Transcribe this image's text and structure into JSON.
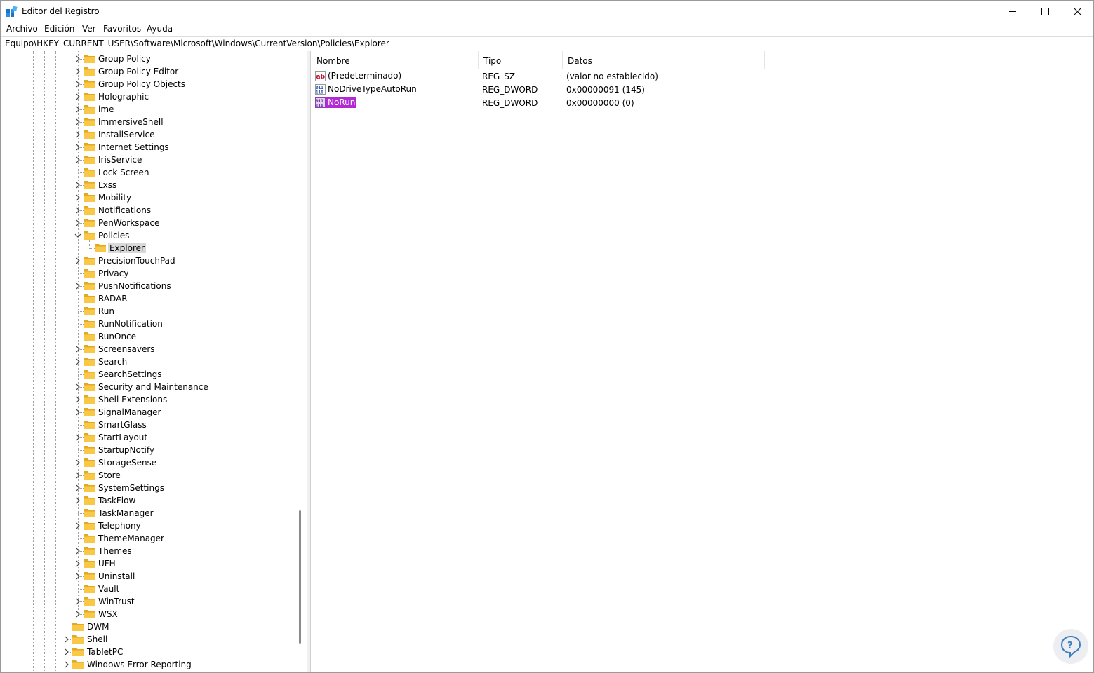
{
  "window": {
    "title": "Editor del Registro",
    "controls": {
      "minimize": "minimize-icon",
      "maximize": "maximize-icon",
      "close": "close-icon"
    }
  },
  "menu": [
    "Archivo",
    "Edición",
    "Ver",
    "Favoritos",
    "Ayuda"
  ],
  "address": "Equipo\\HKEY_CURRENT_USER\\Software\\Microsoft\\Windows\\CurrentVersion\\Policies\\Explorer",
  "tree": {
    "items": [
      {
        "label": "Group Policy",
        "level": 1,
        "expander": "collapsed"
      },
      {
        "label": "Group Policy Editor",
        "level": 1,
        "expander": "collapsed"
      },
      {
        "label": "Group Policy Objects",
        "level": 1,
        "expander": "collapsed"
      },
      {
        "label": "Holographic",
        "level": 1,
        "expander": "collapsed"
      },
      {
        "label": "ime",
        "level": 1,
        "expander": "collapsed"
      },
      {
        "label": "ImmersiveShell",
        "level": 1,
        "expander": "collapsed"
      },
      {
        "label": "InstallService",
        "level": 1,
        "expander": "collapsed"
      },
      {
        "label": "Internet Settings",
        "level": 1,
        "expander": "collapsed"
      },
      {
        "label": "IrisService",
        "level": 1,
        "expander": "collapsed"
      },
      {
        "label": "Lock Screen",
        "level": 1,
        "expander": "none"
      },
      {
        "label": "Lxss",
        "level": 1,
        "expander": "collapsed"
      },
      {
        "label": "Mobility",
        "level": 1,
        "expander": "collapsed"
      },
      {
        "label": "Notifications",
        "level": 1,
        "expander": "collapsed"
      },
      {
        "label": "PenWorkspace",
        "level": 1,
        "expander": "collapsed"
      },
      {
        "label": "Policies",
        "level": 1,
        "expander": "expanded"
      },
      {
        "label": "Explorer",
        "level": 2,
        "expander": "none",
        "selected": true
      },
      {
        "label": "PrecisionTouchPad",
        "level": 1,
        "expander": "collapsed"
      },
      {
        "label": "Privacy",
        "level": 1,
        "expander": "none"
      },
      {
        "label": "PushNotifications",
        "level": 1,
        "expander": "collapsed"
      },
      {
        "label": "RADAR",
        "level": 1,
        "expander": "none"
      },
      {
        "label": "Run",
        "level": 1,
        "expander": "none"
      },
      {
        "label": "RunNotification",
        "level": 1,
        "expander": "none"
      },
      {
        "label": "RunOnce",
        "level": 1,
        "expander": "none"
      },
      {
        "label": "Screensavers",
        "level": 1,
        "expander": "collapsed"
      },
      {
        "label": "Search",
        "level": 1,
        "expander": "collapsed"
      },
      {
        "label": "SearchSettings",
        "level": 1,
        "expander": "none"
      },
      {
        "label": "Security and Maintenance",
        "level": 1,
        "expander": "collapsed"
      },
      {
        "label": "Shell Extensions",
        "level": 1,
        "expander": "collapsed"
      },
      {
        "label": "SignalManager",
        "level": 1,
        "expander": "collapsed"
      },
      {
        "label": "SmartGlass",
        "level": 1,
        "expander": "none"
      },
      {
        "label": "StartLayout",
        "level": 1,
        "expander": "collapsed"
      },
      {
        "label": "StartupNotify",
        "level": 1,
        "expander": "none"
      },
      {
        "label": "StorageSense",
        "level": 1,
        "expander": "collapsed"
      },
      {
        "label": "Store",
        "level": 1,
        "expander": "collapsed"
      },
      {
        "label": "SystemSettings",
        "level": 1,
        "expander": "collapsed"
      },
      {
        "label": "TaskFlow",
        "level": 1,
        "expander": "collapsed"
      },
      {
        "label": "TaskManager",
        "level": 1,
        "expander": "none"
      },
      {
        "label": "Telephony",
        "level": 1,
        "expander": "collapsed"
      },
      {
        "label": "ThemeManager",
        "level": 1,
        "expander": "none"
      },
      {
        "label": "Themes",
        "level": 1,
        "expander": "collapsed"
      },
      {
        "label": "UFH",
        "level": 1,
        "expander": "collapsed"
      },
      {
        "label": "Uninstall",
        "level": 1,
        "expander": "collapsed"
      },
      {
        "label": "Vault",
        "level": 1,
        "expander": "none"
      },
      {
        "label": "WinTrust",
        "level": 1,
        "expander": "collapsed"
      },
      {
        "label": "WSX",
        "level": 1,
        "expander": "collapsed"
      },
      {
        "label": "DWM",
        "level": 0,
        "expander": "none"
      },
      {
        "label": "Shell",
        "level": 0,
        "expander": "collapsed"
      },
      {
        "label": "TabletPC",
        "level": 0,
        "expander": "collapsed"
      },
      {
        "label": "Windows Error Reporting",
        "level": 0,
        "expander": "collapsed"
      }
    ]
  },
  "values": {
    "columns": [
      "Nombre",
      "Tipo",
      "Datos"
    ],
    "rows": [
      {
        "name": "(Predeterminado)",
        "type": "REG_SZ",
        "data": "(valor no establecido)",
        "icon": "string-value-icon"
      },
      {
        "name": "NoDriveTypeAutoRun",
        "type": "REG_DWORD",
        "data": "0x00000091 (145)",
        "icon": "binary-value-icon"
      },
      {
        "name": "NoRun",
        "type": "REG_DWORD",
        "data": "0x00000000 (0)",
        "icon": "binary-value-icon",
        "selected": true
      }
    ]
  },
  "colors": {
    "selection": "#b12ad4",
    "folder": "#f8c846",
    "tree_selection": "#d9d9d9"
  }
}
